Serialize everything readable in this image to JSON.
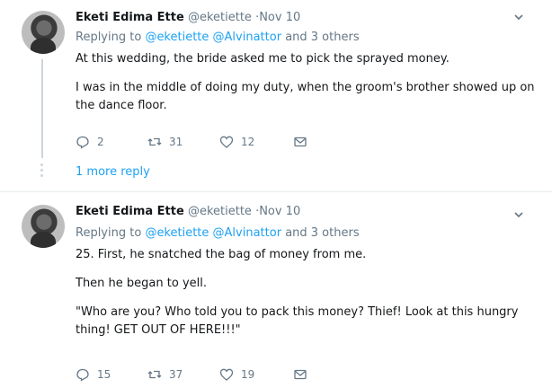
{
  "tweets": [
    {
      "name": "Eketi Edima Ette",
      "handle": "@eketiette",
      "time": "·Nov 10",
      "replying_prefix": "Replying to",
      "mentions": "@eketiette @Alvinattor",
      "replying_suffix": "and 3 others",
      "lines": [
        "At this wedding, the bride asked me to pick the sprayed money.",
        "",
        "I was in the middle of doing my duty, when the groom's brother showed up on",
        "the dance floor."
      ],
      "replies": "2",
      "retweets": "31",
      "likes": "12"
    },
    {
      "name": "Eketi Edima Ette",
      "handle": "@eketiette",
      "time": "·Nov 10",
      "replying_prefix": "Replying to",
      "mentions": "@eketiette @Alvinattor",
      "replying_suffix": "and 3 others",
      "lines": [
        "25. First, he snatched the bag of money from me.",
        "",
        "Then he began to yell.",
        "",
        "\"Who are you? Who told you to pack this money? Thief! Look at this hungry",
        "thing! GET OUT OF HERE!!!\""
      ],
      "replies": "15",
      "retweets": "37",
      "likes": "19"
    }
  ],
  "more_reply": "1 more reply",
  "icons": {
    "reply": "reply-icon",
    "retweet": "retweet-icon",
    "like": "heart-icon",
    "dm": "envelope-icon",
    "menu": "chevron-down-icon"
  }
}
